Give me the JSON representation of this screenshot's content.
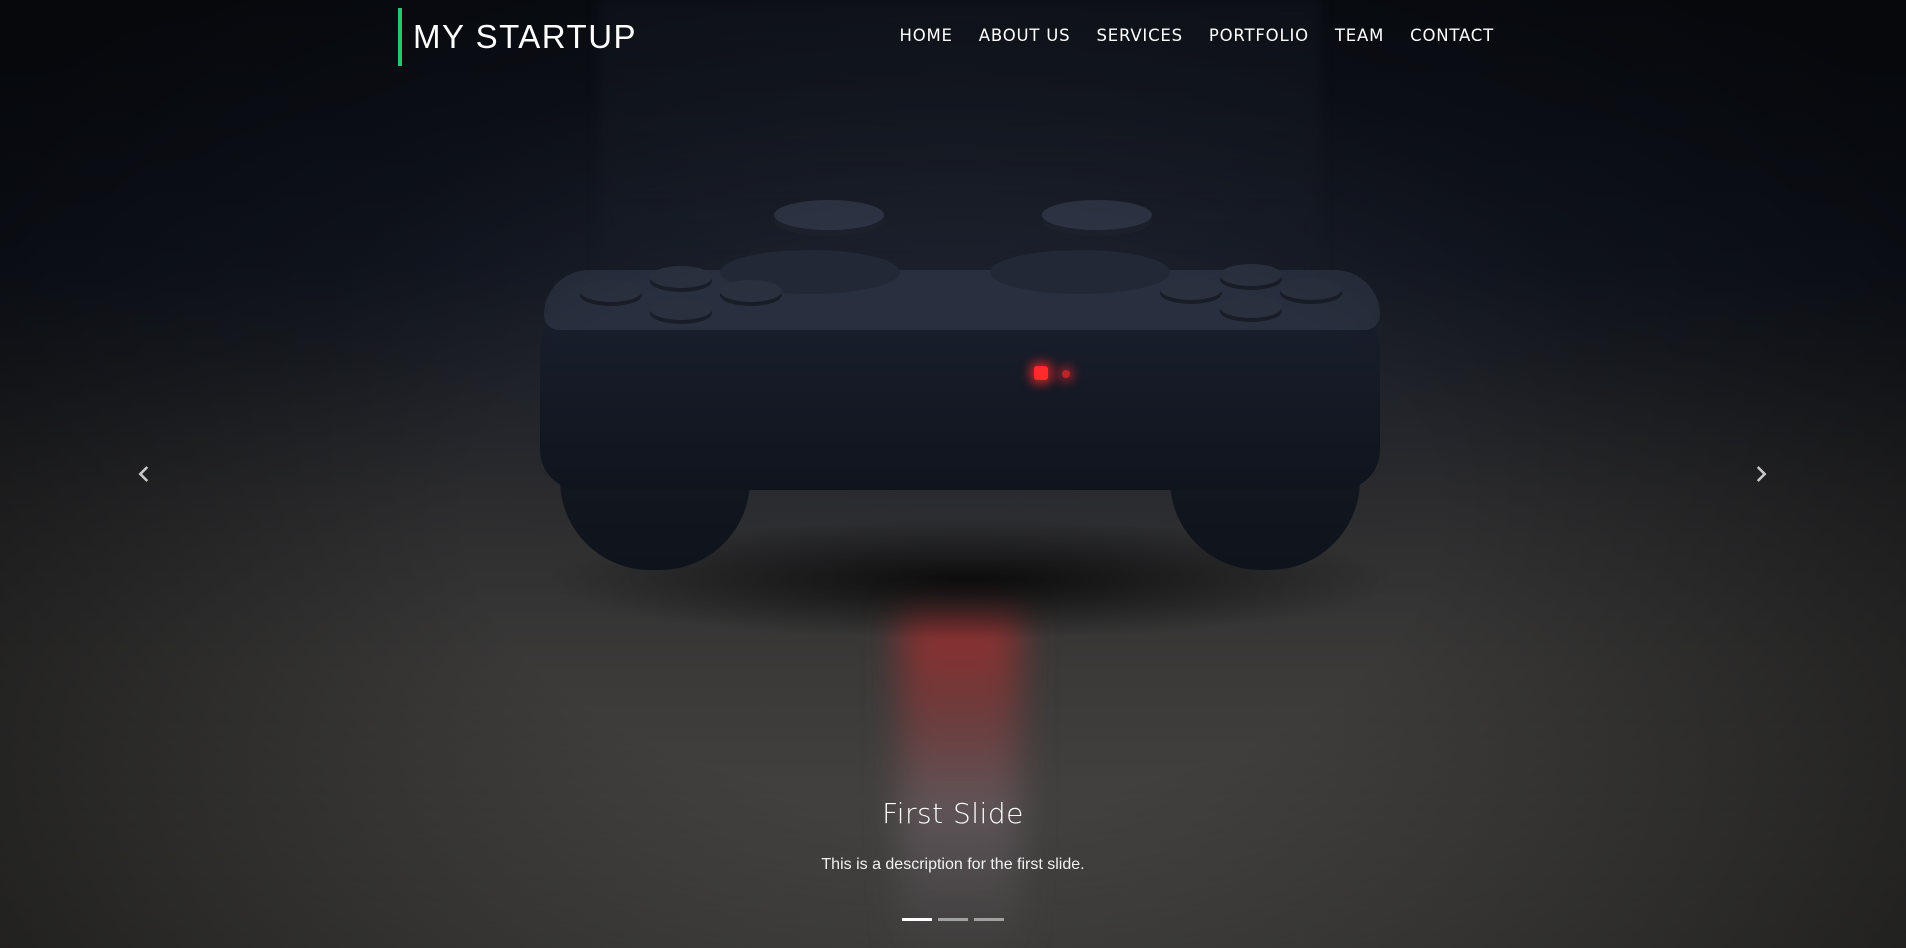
{
  "brand": {
    "name": "MY STARTUP",
    "accent_color": "#28c76f"
  },
  "nav": {
    "items": [
      {
        "label": "HOME"
      },
      {
        "label": "ABOUT US"
      },
      {
        "label": "SERVICES"
      },
      {
        "label": "PORTFOLIO"
      },
      {
        "label": "TEAM"
      },
      {
        "label": "CONTACT"
      }
    ]
  },
  "carousel": {
    "prev_icon": "chevron-left-icon",
    "next_icon": "chevron-right-icon",
    "slide": {
      "title": "First Slide",
      "description": "This is a description for the first slide."
    },
    "indicator_count": 3,
    "active_index": 0
  }
}
